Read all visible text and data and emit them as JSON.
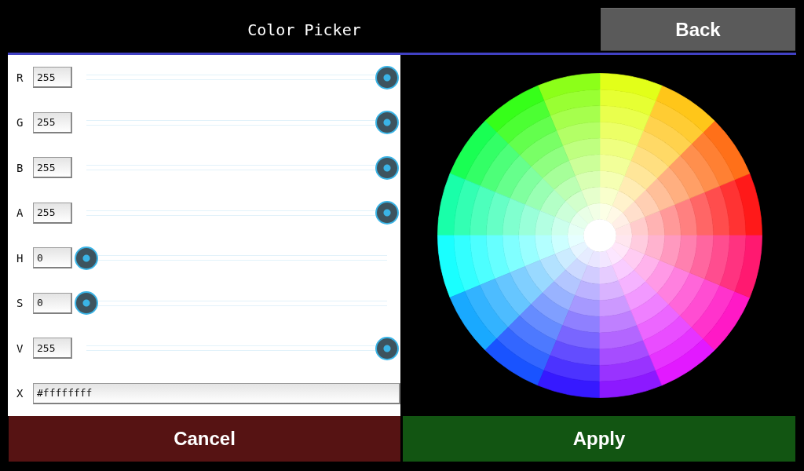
{
  "header": {
    "title": "Color Picker",
    "back_button": "Back"
  },
  "channels": [
    {
      "label": "R",
      "value": "255",
      "level": 1
    },
    {
      "label": "G",
      "value": "255",
      "level": 1
    },
    {
      "label": "B",
      "value": "255",
      "level": 1
    },
    {
      "label": "A",
      "value": "255",
      "level": 1
    },
    {
      "label": "H",
      "value": "0",
      "level": 0
    },
    {
      "label": "S",
      "value": "0",
      "level": 0
    },
    {
      "label": "V",
      "value": "255",
      "level": 1
    }
  ],
  "hex": {
    "label": "X",
    "value": "#ffffffff"
  },
  "buttons": [
    {
      "label": "Cancel",
      "kind": "cancel"
    },
    {
      "label": "Apply",
      "kind": "apply"
    }
  ]
}
